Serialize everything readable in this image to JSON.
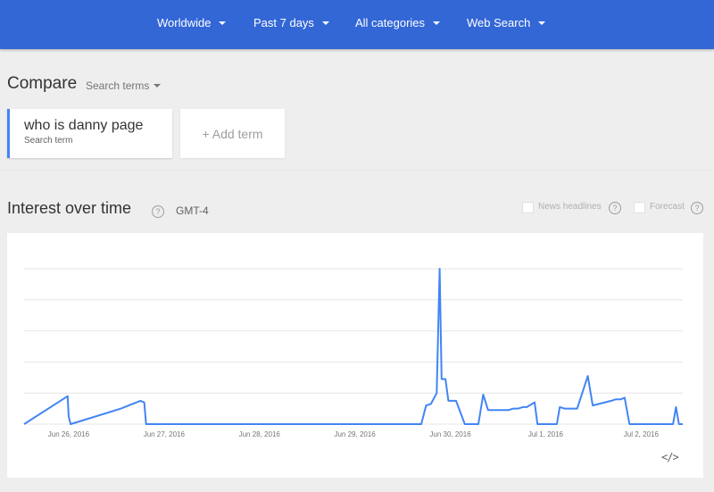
{
  "header": {
    "filters": [
      {
        "label": "Worldwide"
      },
      {
        "label": "Past 7 days"
      },
      {
        "label": "All categories"
      },
      {
        "label": "Web Search"
      }
    ]
  },
  "compare": {
    "title": "Compare",
    "search_terms_label": "Search terms",
    "term": {
      "value": "who is danny page",
      "sublabel": "Search term",
      "color": "#4285f4"
    },
    "add_term_label": "+ Add term"
  },
  "interest": {
    "title": "Interest over time",
    "timezone": "GMT-4",
    "options": [
      {
        "label": "News headlines"
      },
      {
        "label": "Forecast"
      }
    ],
    "embed_icon": "</>"
  },
  "chart_data": {
    "type": "line",
    "title": "",
    "xlabel": "",
    "ylabel": "",
    "ylim": [
      0,
      100
    ],
    "grid": true,
    "line_color": "#4285f4",
    "x_ticks": [
      "Jun 26, 2016",
      "Jun 27, 2016",
      "Jun 28, 2016",
      "Jun 29, 2016",
      "Jun 30, 2016",
      "Jul 1, 2016",
      "Jul 2, 2016"
    ],
    "x": [
      0,
      4.5,
      4.6,
      4.8,
      10.0,
      12.0,
      12.4,
      12.6,
      40.0,
      41.0,
      41.5,
      42.0,
      42.6,
      42.9,
      43.1,
      43.5,
      43.8,
      44.2,
      44.6,
      45.5,
      46.9,
      47.4,
      47.9,
      49.2,
      50.0,
      50.5,
      51.0,
      51.5,
      51.9,
      52.7,
      53.0,
      55.0,
      55.3,
      55.8,
      57.1,
      58.2,
      58.7,
      60.6,
      61.1,
      61.6,
      62.0,
      62.5,
      63.0,
      67.0,
      67.3,
      67.6,
      68.0
    ],
    "y": [
      0,
      18,
      5,
      0,
      10,
      15,
      14,
      0,
      0,
      0,
      12,
      13,
      20,
      100,
      29,
      29,
      15,
      15,
      15,
      0,
      0,
      19,
      9,
      9,
      9,
      10,
      10,
      11,
      11,
      14,
      0,
      0,
      11,
      10,
      10,
      31,
      12,
      15,
      16,
      16,
      17,
      0,
      0,
      0,
      11,
      0,
      0
    ]
  }
}
